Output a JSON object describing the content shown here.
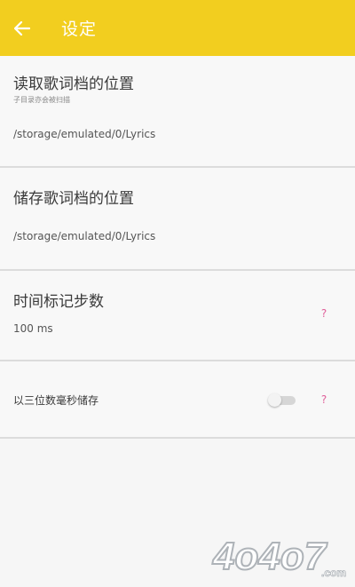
{
  "header": {
    "title": "设定",
    "back_icon": "arrow-left-icon",
    "background": "#f2ce1f"
  },
  "settings": [
    {
      "title": "读取歌词档的位置",
      "subtitle": "子目录亦会被扫描",
      "value": "/storage/emulated/0/Lyrics"
    },
    {
      "title": "储存歌词档的位置",
      "value": "/storage/emulated/0/Lyrics"
    },
    {
      "title": "时间标记步数",
      "value": "100 ms",
      "help": "?"
    },
    {
      "title": "以三位数毫秒储存",
      "toggle": false,
      "help": "?"
    }
  ],
  "watermark": {
    "text": "4o4o7",
    "suffix": ".com"
  },
  "colors": {
    "accent": "#f2ce1f",
    "help": "#e0609a"
  }
}
